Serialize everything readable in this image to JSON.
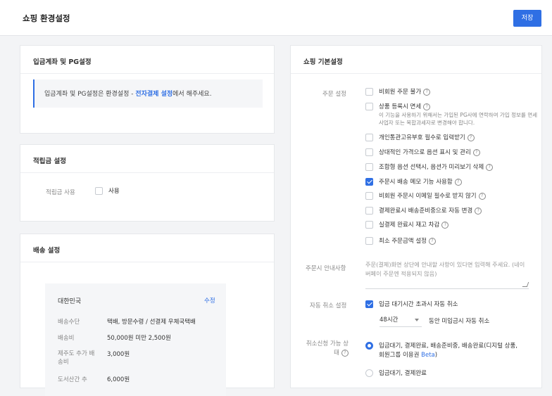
{
  "header": {
    "title": "쇼핑 환경설정",
    "save_label": "저장"
  },
  "pg": {
    "title": "입금계좌 및 PG설정",
    "notice_before": "입금계좌 및 PG설정은 환경설정 - ",
    "notice_link": "전자결제 설정",
    "notice_after": "에서 해주세요."
  },
  "points": {
    "title": "적립금 설정",
    "label": "적립금 사용",
    "option": "사용"
  },
  "shipping": {
    "title": "배송 설정",
    "country": "대한민국",
    "edit": "수정",
    "rows": [
      {
        "label": "배송수단",
        "value": "택배, 방문수령 / 선결제 우체국택배"
      },
      {
        "label": "배송비",
        "value": "50,000원 미만 2,500원"
      },
      {
        "label": "제주도 추가 배송비",
        "value": "3,000원"
      },
      {
        "label": "도서산간 추",
        "value": "6,000원"
      }
    ]
  },
  "basic": {
    "title": "쇼핑 기본설정",
    "order_label": "주문 설정",
    "help": "?",
    "options": [
      {
        "label": "비회원 주문 불가",
        "checked": false
      },
      {
        "label": "상품 등록시 면세",
        "checked": false
      },
      {
        "label": "개인통관고유부호 필수로 입력받기",
        "checked": false
      },
      {
        "label": "상대적인 가격으로 옵션 표시 및 관리",
        "checked": false
      },
      {
        "label": "조합형 옵션 선택시, 옵션가 미리보기 삭제",
        "checked": false
      },
      {
        "label": "주문시 배송 메모 기능 사용함",
        "checked": true
      },
      {
        "label": "비회원 주문시 이메일 필수로 받지 않기",
        "checked": false
      },
      {
        "label": "결제완료시 배송준비중으로 자동 변경",
        "checked": false
      },
      {
        "label": "실결제 완료시 재고 차감",
        "checked": false
      },
      {
        "label": "최소 주문금액 설정",
        "checked": false
      }
    ],
    "taxfree_desc": "이 기능을 사용하기 위해서는 가입된 PG사에 연락하여 가입 정보를 면세사업자 또는 복합과세자로 변경해야 합니다.",
    "guide_label": "주문시 안내사항",
    "guide_placeholder": "주문(결제)화면 상단에 안내할 사항이 있다면 입력해 주세요. (네이버페이 주문엔 적용되지 않음)",
    "auto_cancel_label": "자동 취소 설정",
    "auto_cancel_option": "입금 대기시간 초과시 자동 취소",
    "hours": "48시간",
    "hours_suffix": "동안 미입금시 자동 취소",
    "cancel_state_label_1": "취소신청 가능 상",
    "cancel_state_label_2": "태",
    "cancel_opt1_line1": "입금대기, 결제완료, 배송준비중, 배송완료(디지털 상품,",
    "cancel_opt1_line2": "회원그룹 이용권 ",
    "beta": "Beta",
    "cancel_opt2": "입금대기, 결제완료"
  }
}
